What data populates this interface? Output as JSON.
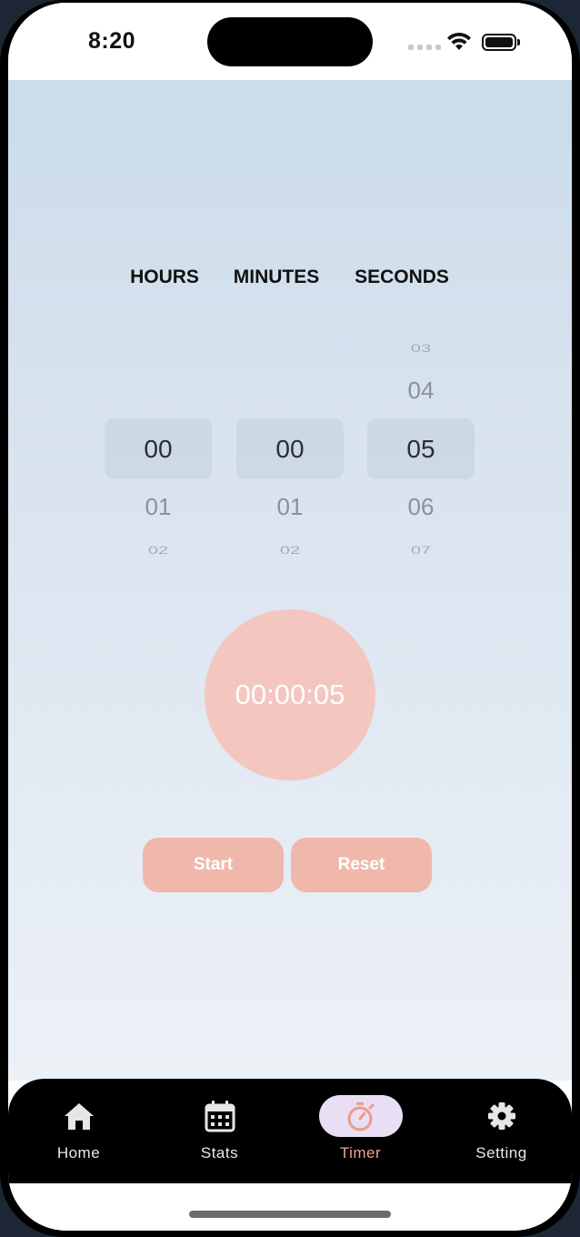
{
  "status": {
    "time": "8:20"
  },
  "picker": {
    "labels": {
      "hours": "HOURS",
      "minutes": "MINUTES",
      "seconds": "SECONDS"
    },
    "hours": {
      "above_far": "",
      "above_near": "",
      "selected": "00",
      "below_near": "01",
      "below_far": "02"
    },
    "minutes": {
      "above_far": "",
      "above_near": "",
      "selected": "00",
      "below_near": "01",
      "below_far": "02"
    },
    "seconds": {
      "above_far": "03",
      "above_near": "04",
      "selected": "05",
      "below_near": "06",
      "below_far": "07"
    }
  },
  "timer": {
    "display": "00:00:05"
  },
  "controls": {
    "start_label": "Start",
    "reset_label": "Reset"
  },
  "tabs": [
    {
      "label": "Home",
      "icon": "home-icon",
      "active": false
    },
    {
      "label": "Stats",
      "icon": "calendar-icon",
      "active": false
    },
    {
      "label": "Timer",
      "icon": "stopwatch-icon",
      "active": true
    },
    {
      "label": "Setting",
      "icon": "gear-icon",
      "active": false
    }
  ],
  "colors": {
    "accent": "#f0b8ab",
    "timer_circle": "#f3c7bf",
    "active_tab_bg": "#e8dff5",
    "active_tab_text": "#f0a090"
  }
}
